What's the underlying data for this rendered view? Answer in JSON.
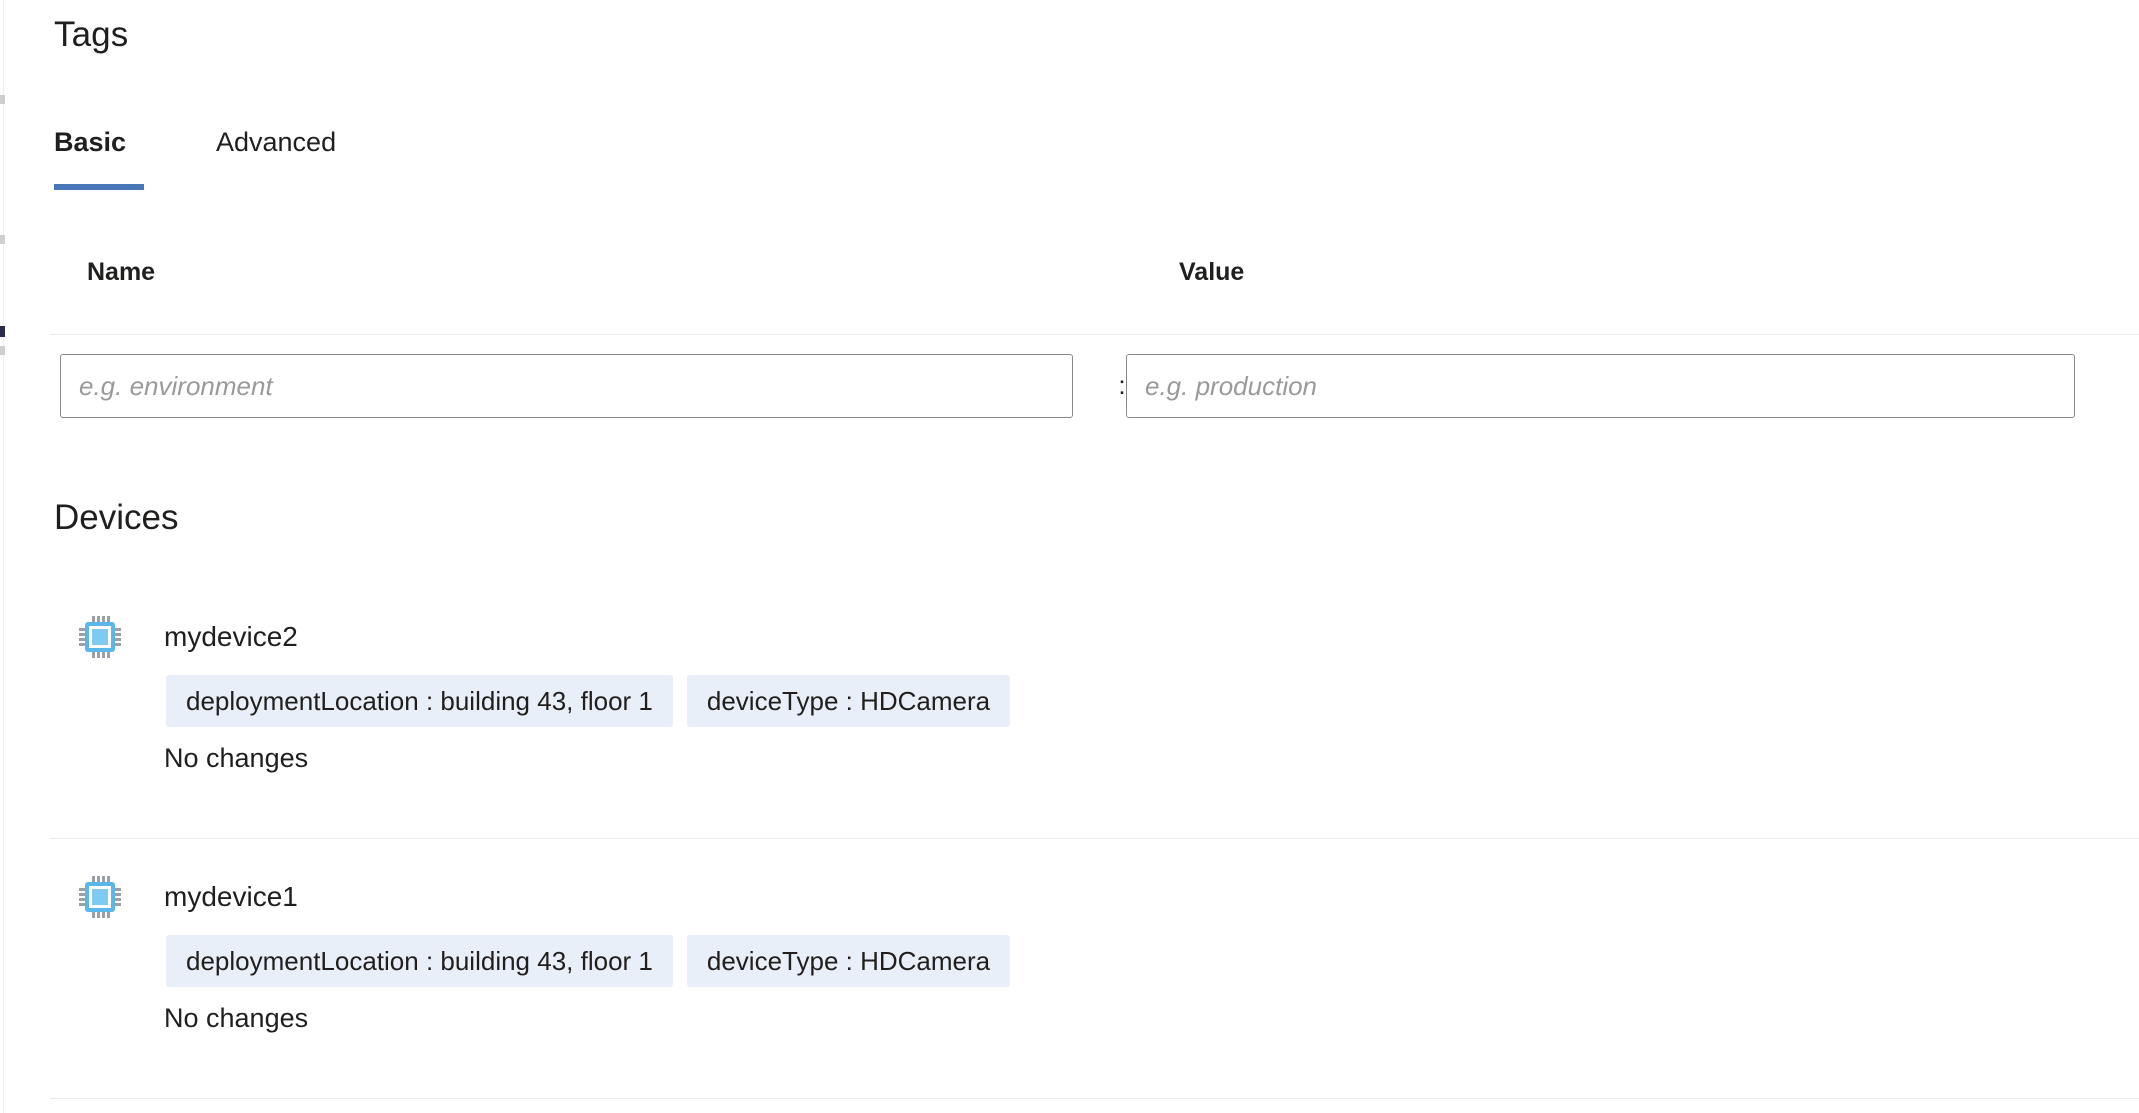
{
  "tags_section": {
    "heading": "Tags",
    "tabs": [
      {
        "label": "Basic",
        "selected": true
      },
      {
        "label": "Advanced",
        "selected": false
      }
    ],
    "columns": {
      "name_header": "Name",
      "value_header": "Value"
    },
    "separator": ":",
    "entry_row": {
      "name_value": "",
      "name_placeholder": "e.g. environment",
      "value_value": "",
      "value_placeholder": "e.g. production"
    }
  },
  "devices_section": {
    "heading": "Devices",
    "devices": [
      {
        "name": "mydevice2",
        "icon": "microchip-icon",
        "tags": [
          "deploymentLocation : building 43, floor 1",
          "deviceType : HDCamera"
        ],
        "status": "No changes"
      },
      {
        "name": "mydevice1",
        "icon": "microchip-icon",
        "tags": [
          "deploymentLocation : building 43, floor 1",
          "deviceType : HDCamera"
        ],
        "status": "No changes"
      }
    ]
  },
  "colors": {
    "accent": "#4878b8",
    "chip_background": "#e9eff8",
    "text": "#201f1e",
    "divider": "#edebe9",
    "input_border": "#8a8886",
    "placeholder": "#9b9a99",
    "icon_blue": "#55b3e6"
  }
}
